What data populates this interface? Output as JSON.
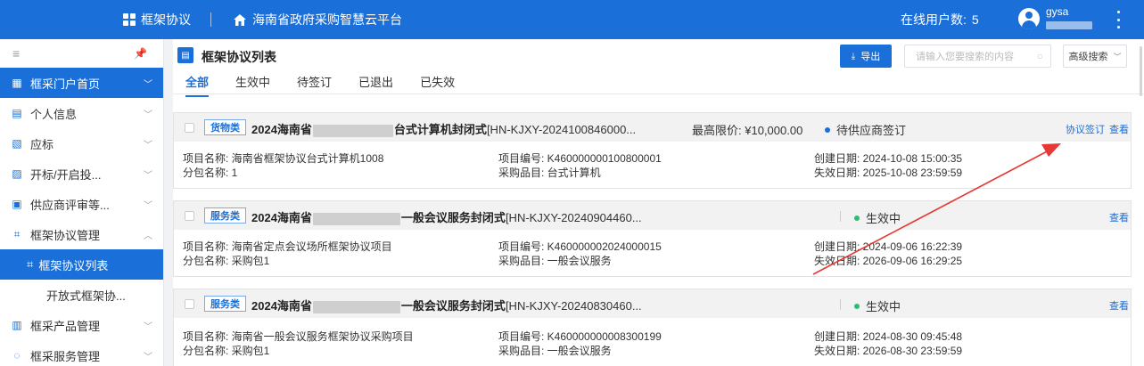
{
  "topbar": {
    "app_name": "框架协议",
    "platform": "海南省政府采购智慧云平台",
    "online_label": "在线用户数:",
    "online_count": "5",
    "username": "gysa"
  },
  "sidebar": {
    "items": [
      {
        "label": "框采门户首页"
      },
      {
        "label": "个人信息"
      },
      {
        "label": "应标"
      },
      {
        "label": "开标/开启投..."
      },
      {
        "label": "供应商评审等..."
      },
      {
        "label": "框架协议管理"
      },
      {
        "label": "框架协议列表"
      },
      {
        "label": "开放式框架协..."
      },
      {
        "label": "框采产品管理"
      },
      {
        "label": "框采服务管理"
      }
    ]
  },
  "main": {
    "title": "框架协议列表",
    "export_label": "导出",
    "search_placeholder": "请输入您要搜索的内容",
    "adv_search_label": "高级搜索",
    "tabs": [
      {
        "label": "全部"
      },
      {
        "label": "生效中"
      },
      {
        "label": "待签订"
      },
      {
        "label": "已退出"
      },
      {
        "label": "已失效"
      }
    ]
  },
  "cards": [
    {
      "category": "货物类",
      "title_prefix": "2024海南省",
      "title_suffix": "台式计算机封闭式",
      "code": "[HN-KJXY-2024100846000...",
      "price_label": "最高限价:",
      "price": "¥10,000.00",
      "status": "待供应商签订",
      "action_sign": "协议签订",
      "action_view": "查看",
      "project_name": "项目名称: 海南省框架协议台式计算机1008",
      "package_name": "分包名称: 1",
      "project_no": "项目编号: K460000000100800001",
      "item": "采购品目: 台式计算机",
      "created": "创建日期: 2024-10-08 15:00:35",
      "expire": "失效日期: 2025-10-08 23:59:59"
    },
    {
      "category": "服务类",
      "title_prefix": "2024海南省",
      "title_suffix": "一般会议服务封闭式",
      "code": "[HN-KJXY-20240904460...",
      "status": "生效中",
      "action_view": "查看",
      "project_name": "项目名称: 海南省定点会议场所框架协议项目",
      "package_name": "分包名称: 采购包1",
      "project_no": "项目编号: K460000002024000015",
      "item": "采购品目: 一般会议服务",
      "created": "创建日期: 2024-09-06 16:22:39",
      "expire": "失效日期: 2026-09-06 16:29:25"
    },
    {
      "category": "服务类",
      "title_prefix": "2024海南省",
      "title_suffix": "一般会议服务封闭式",
      "code": "[HN-KJXY-20240830460...",
      "status": "生效中",
      "action_view": "查看",
      "project_name": "项目名称: 海南省一般会议服务框架协议采购项目",
      "package_name": "分包名称: 采购包1",
      "project_no": "项目编号: K460000000008300199",
      "item": "采购品目: 一般会议服务",
      "created": "创建日期: 2024-08-30 09:45:48",
      "expire": "失效日期: 2026-08-30 23:59:59"
    }
  ],
  "colors": {
    "primary": "#1a6fd8",
    "status_green": "#2dbd6e",
    "arrow": "#e53935"
  }
}
